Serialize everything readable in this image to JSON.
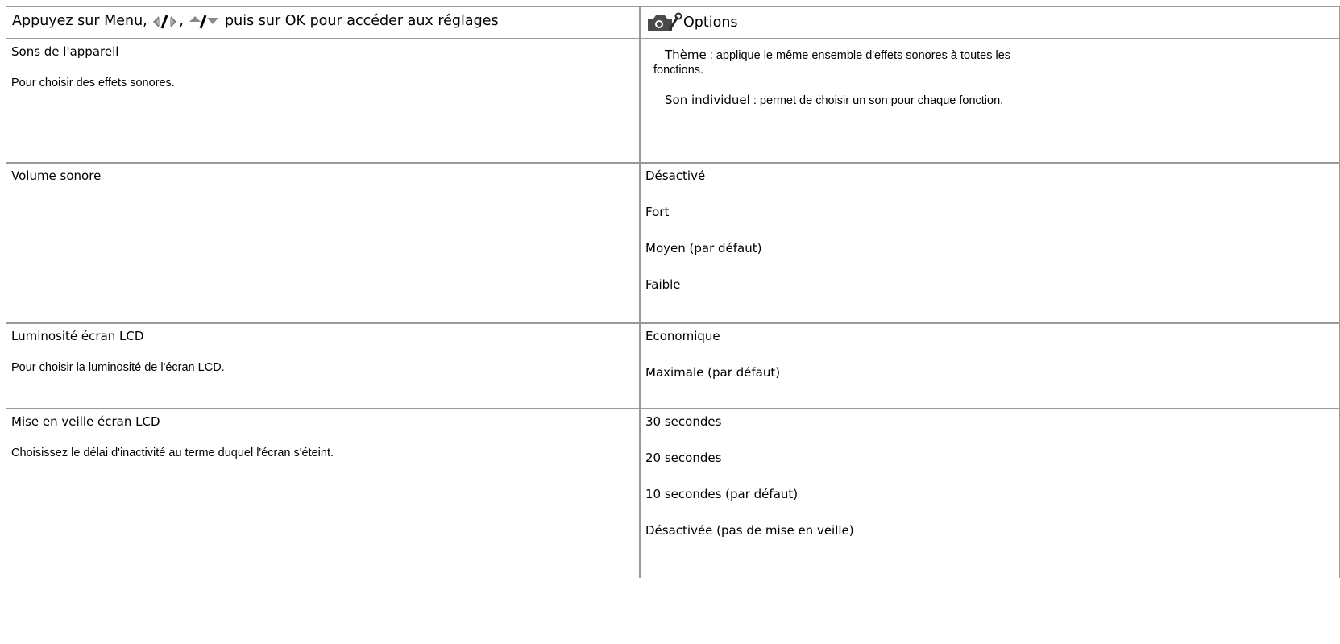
{
  "header": {
    "instruction_part1": "Appuyez sur Menu,",
    "instruction_part2": "puis sur OK pour accéder aux réglages",
    "options_label": "Options",
    "icons": [
      "left-right-arrows-icon",
      "up-down-arrows-icon",
      "camera-wrench-icon"
    ]
  },
  "rows": [
    {
      "title": "Sons de l'appareil",
      "description": "Pour choisir des effets sonores.",
      "options_detail": [
        {
          "term": "Thème",
          "text_line1": " : applique le même ensemble d'effets sonores à toutes les",
          "text_line2": "fonctions."
        },
        {
          "term": "Son individuel",
          "text_line1": " : permet de choisir un son pour chaque fonction."
        }
      ]
    },
    {
      "title": "Volume sonore",
      "options": [
        "Désactivé",
        "Fort",
        "Moyen (par défaut)",
        "Faible"
      ]
    },
    {
      "title": "Luminosité écran LCD",
      "description": "Pour choisir la luminosité de l'écran LCD.",
      "options": [
        "Economique",
        "Maximale (par défaut)"
      ]
    },
    {
      "title": "Mise en veille écran LCD",
      "description": "Choisissez le délai d'inactivité au terme duquel l'écran s'éteint.",
      "options": [
        "30 secondes",
        "20 secondes",
        "10 secondes (par défaut)",
        "Désactivée (pas de mise en veille)"
      ]
    }
  ]
}
